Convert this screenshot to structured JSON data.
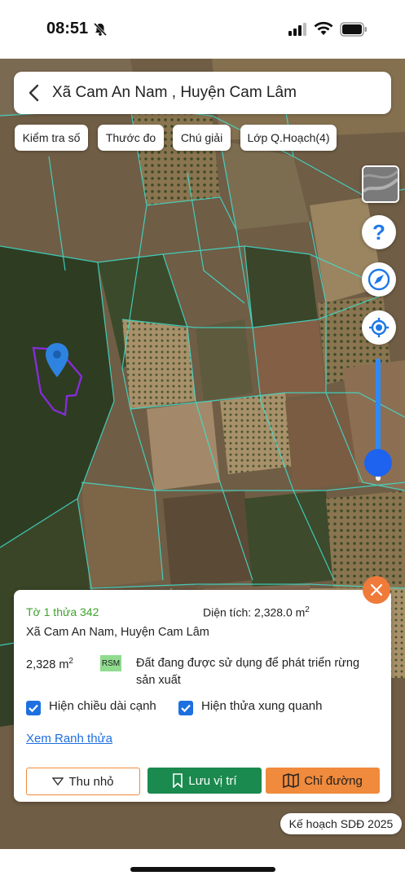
{
  "status_bar": {
    "time": "08:51"
  },
  "header": {
    "title": "Xã Cam An Nam , Huyện Cam Lâm"
  },
  "chips": [
    "Kiểm tra số",
    "Thước đo",
    "Chú giải",
    "Lớp Q.Hoạch(4)"
  ],
  "map_controls": {
    "zoom_level_fraction": 0.85
  },
  "panel": {
    "parcel_id": "Tờ 1 thửa 342",
    "area_label": "Diện tích: 2,328.0 m",
    "area_sup": "2",
    "location": "Xã Cam An Nam, Huyện Cam Lâm",
    "area_short": "2,328 m",
    "area_short_sup": "2",
    "land_code": "RSM",
    "land_desc_line1": "Đất đang được sử dụng để phát triển rừng",
    "land_desc_line2": "sản xuất",
    "checkbox_edge_length": "Hiện chiều dài cạnh",
    "checkbox_neighbors": "Hiện thửa xung quanh",
    "link_boundary": "Xem Ranh thửa",
    "btn_minimize": "Thu nhỏ",
    "btn_save": "Lưu vị trí",
    "btn_directions": "Chỉ đường"
  },
  "plan_badge": "Kế hoạch SDĐ 2025",
  "colors": {
    "accent_green": "#1a8a4e",
    "accent_orange": "#f08a3c",
    "parcel_text_green": "#3fa32c",
    "link_blue": "#1e6fe0",
    "parcel_boundary": "#8a2be2",
    "map_lines": "#3fe0d0"
  }
}
